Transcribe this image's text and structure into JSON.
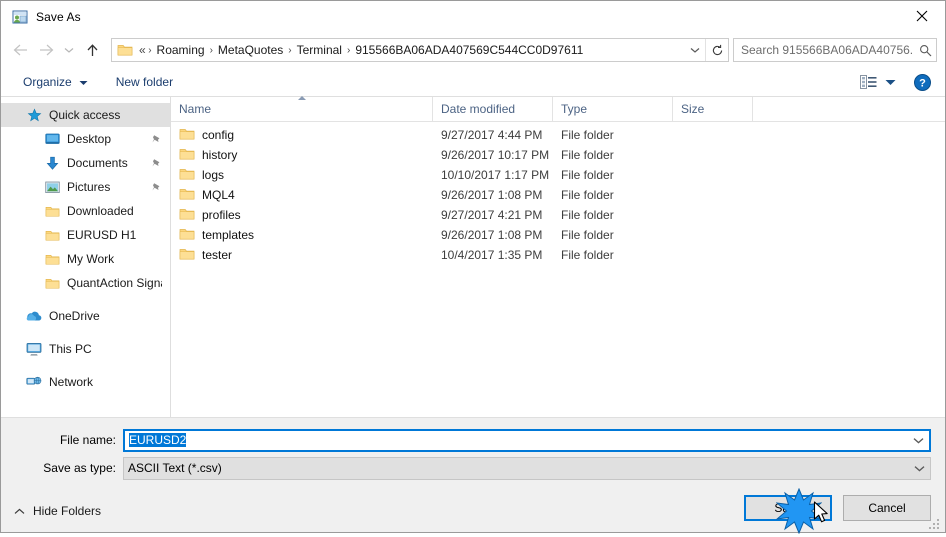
{
  "window": {
    "title": "Save As",
    "icon": "save-as-icon",
    "close_label": "✕"
  },
  "nav": {
    "back_icon": "arrow-left-icon",
    "forward_icon": "arrow-right-icon",
    "recent_icon": "chevron-down-icon",
    "up_icon": "arrow-up-icon",
    "address": {
      "folder_icon": "folder-icon",
      "lead": "«",
      "crumbs": [
        "Roaming",
        "MetaQuotes",
        "Terminal",
        "915566BA06ADA407569C544CC0D97611"
      ],
      "separator": "›",
      "dropdown_icon": "chevron-down-icon",
      "refresh_icon": "refresh-icon"
    },
    "search": {
      "placeholder": "Search 915566BA06ADA40756...",
      "icon": "search-icon"
    }
  },
  "toolbar": {
    "organize_label": "Organize",
    "organize_caret": "▾",
    "new_folder_label": "New folder",
    "view_icon": "list-view-icon",
    "view_caret": "▾",
    "help_icon": "help-icon",
    "help_label": "?"
  },
  "sidebar": {
    "items": [
      {
        "label": "Quick access",
        "icon": "star-icon",
        "level": 0,
        "selected": true,
        "pinned": false
      },
      {
        "label": "Desktop",
        "icon": "desktop-icon",
        "level": 1,
        "selected": false,
        "pinned": true
      },
      {
        "label": "Documents",
        "icon": "documents-icon",
        "level": 1,
        "selected": false,
        "pinned": true
      },
      {
        "label": "Pictures",
        "icon": "pictures-icon",
        "level": 1,
        "selected": false,
        "pinned": true
      },
      {
        "label": "Downloaded",
        "icon": "folder-icon",
        "level": 1,
        "selected": false,
        "pinned": false
      },
      {
        "label": "EURUSD H1",
        "icon": "folder-icon",
        "level": 1,
        "selected": false,
        "pinned": false
      },
      {
        "label": "My Work",
        "icon": "folder-icon",
        "level": 1,
        "selected": false,
        "pinned": false
      },
      {
        "label": "QuantAction Signal",
        "icon": "folder-icon",
        "level": 1,
        "selected": false,
        "pinned": false
      },
      {
        "label": "OneDrive",
        "icon": "onedrive-icon",
        "level": 0,
        "selected": false,
        "pinned": false,
        "spaced": true
      },
      {
        "label": "This PC",
        "icon": "thispc-icon",
        "level": 0,
        "selected": false,
        "pinned": false,
        "spaced": true
      },
      {
        "label": "Network",
        "icon": "network-icon",
        "level": 0,
        "selected": false,
        "pinned": false,
        "spaced": true
      }
    ]
  },
  "filelist": {
    "columns": [
      {
        "label": "Name",
        "sorted": true
      },
      {
        "label": "Date modified",
        "sorted": false
      },
      {
        "label": "Type",
        "sorted": false
      },
      {
        "label": "Size",
        "sorted": false
      }
    ],
    "rows": [
      {
        "name": "config",
        "date": "9/27/2017 4:44 PM",
        "type": "File folder",
        "size": "",
        "icon": "folder-icon"
      },
      {
        "name": "history",
        "date": "9/26/2017 10:17 PM",
        "type": "File folder",
        "size": "",
        "icon": "folder-icon"
      },
      {
        "name": "logs",
        "date": "10/10/2017 1:17 PM",
        "type": "File folder",
        "size": "",
        "icon": "folder-icon"
      },
      {
        "name": "MQL4",
        "date": "9/26/2017 1:08 PM",
        "type": "File folder",
        "size": "",
        "icon": "folder-icon"
      },
      {
        "name": "profiles",
        "date": "9/27/2017 4:21 PM",
        "type": "File folder",
        "size": "",
        "icon": "folder-icon"
      },
      {
        "name": "templates",
        "date": "9/26/2017 1:08 PM",
        "type": "File folder",
        "size": "",
        "icon": "folder-icon"
      },
      {
        "name": "tester",
        "date": "10/4/2017 1:35 PM",
        "type": "File folder",
        "size": "",
        "icon": "folder-icon"
      }
    ]
  },
  "form": {
    "filename_label": "File name:",
    "filename_value": "EURUSD2",
    "filetype_label": "Save as type:",
    "filetype_value": "ASCII Text (*.csv)",
    "dropdown_icon": "chevron-down-icon"
  },
  "actions": {
    "save_label": "Save",
    "cancel_label": "Cancel",
    "hide_folders_label": "Hide Folders",
    "hide_folders_icon": "chevron-up-icon"
  },
  "colors": {
    "accent": "#0078d7",
    "footer": "#f0f0f0",
    "selection": "#e0e0e0",
    "folder": "#fcd77f",
    "header_text": "#4c6384"
  }
}
